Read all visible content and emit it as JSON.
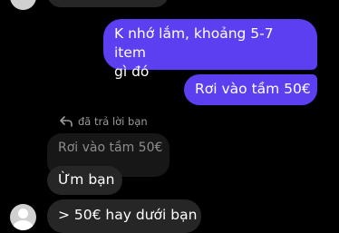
{
  "messages": {
    "sent_1": "K nhớ lắm, khoảng 5-7 item\ngì đó",
    "sent_2": "Rơi vào tầm 50€",
    "reply_label": "đã trả lời bạn",
    "quoted": "Rơi vào tầm 50€",
    "received_1": "Ừm bạn",
    "received_2": "> 50€ hay dưới bạn"
  },
  "icons": {
    "reply": "reply-arrow-icon",
    "avatar": "default-avatar-icon"
  },
  "colors": {
    "background": "#000000",
    "sent_bubble": "#5d3ff2",
    "received_bubble": "#262626",
    "quoted_bubble": "#171717",
    "muted_text": "#9c9c9c"
  }
}
